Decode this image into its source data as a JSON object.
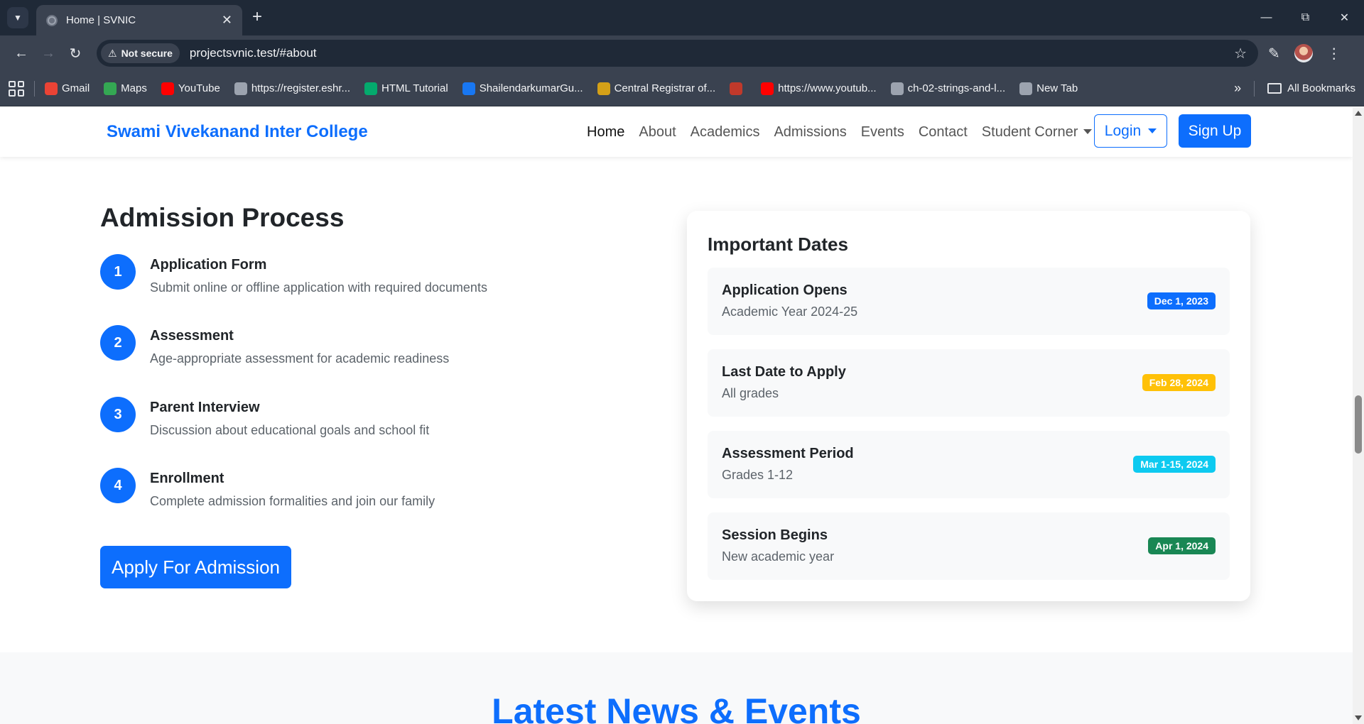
{
  "browser": {
    "tab_title": "Home | SVNIC",
    "security_label": "Not secure",
    "url": "projectsvnic.test/#about",
    "bookmarks": [
      {
        "label": "Gmail",
        "icon": "gmail-icon",
        "color": "#ea4335"
      },
      {
        "label": "Maps",
        "icon": "maps-icon",
        "color": "#34a853"
      },
      {
        "label": "YouTube",
        "icon": "youtube-icon",
        "color": "#ff0000"
      },
      {
        "label": "https://register.eshr...",
        "icon": "emblem-icon",
        "color": "#9ca3af"
      },
      {
        "label": "HTML Tutorial",
        "icon": "w3schools-icon",
        "color": "#04aa6d"
      },
      {
        "label": "ShailendarkumarGu...",
        "icon": "facebook-icon",
        "color": "#1877f2"
      },
      {
        "label": "Central Registrar of...",
        "icon": "emblem-icon",
        "color": "#d4a017"
      },
      {
        "label": "",
        "icon": "page-icon",
        "color": "#c0392b"
      },
      {
        "label": "https://www.youtub...",
        "icon": "youtube-icon",
        "color": "#ff0000"
      },
      {
        "label": "ch-02-strings-and-l...",
        "icon": "globe-icon",
        "color": "#9ca3af"
      },
      {
        "label": "New Tab",
        "icon": "globe-icon",
        "color": "#9ca3af"
      }
    ],
    "all_bookmarks": "All Bookmarks"
  },
  "navbar": {
    "brand": "Swami Vivekanand Inter College",
    "links": [
      "Home",
      "About",
      "Academics",
      "Admissions",
      "Events",
      "Contact",
      "Student Corner"
    ],
    "login": "Login",
    "signup": "Sign Up"
  },
  "admission": {
    "title": "Admission Process",
    "steps": [
      {
        "num": "1",
        "title": "Application Form",
        "desc": "Submit online or offline application with required documents"
      },
      {
        "num": "2",
        "title": "Assessment",
        "desc": "Age-appropriate assessment for academic readiness"
      },
      {
        "num": "3",
        "title": "Parent Interview",
        "desc": "Discussion about educational goals and school fit"
      },
      {
        "num": "4",
        "title": "Enrollment",
        "desc": "Complete admission formalities and join our family"
      }
    ],
    "apply_button": "Apply For Admission"
  },
  "important_dates": {
    "title": "Important Dates",
    "items": [
      {
        "name": "Application Opens",
        "sub": "Academic Year 2024-25",
        "badge": "Dec 1, 2023",
        "badge_bg": "#0d6efd",
        "badge_fg": "#ffffff"
      },
      {
        "name": "Last Date to Apply",
        "sub": "All grades",
        "badge": "Feb 28, 2024",
        "badge_bg": "#ffc107",
        "badge_fg": "#ffffff"
      },
      {
        "name": "Assessment Period",
        "sub": "Grades 1-12",
        "badge": "Mar 1-15, 2024",
        "badge_bg": "#0dcaf0",
        "badge_fg": "#ffffff"
      },
      {
        "name": "Session Begins",
        "sub": "New academic year",
        "badge": "Apr 1, 2024",
        "badge_bg": "#198754",
        "badge_fg": "#ffffff"
      }
    ]
  },
  "news": {
    "title": "Latest News & Events"
  }
}
